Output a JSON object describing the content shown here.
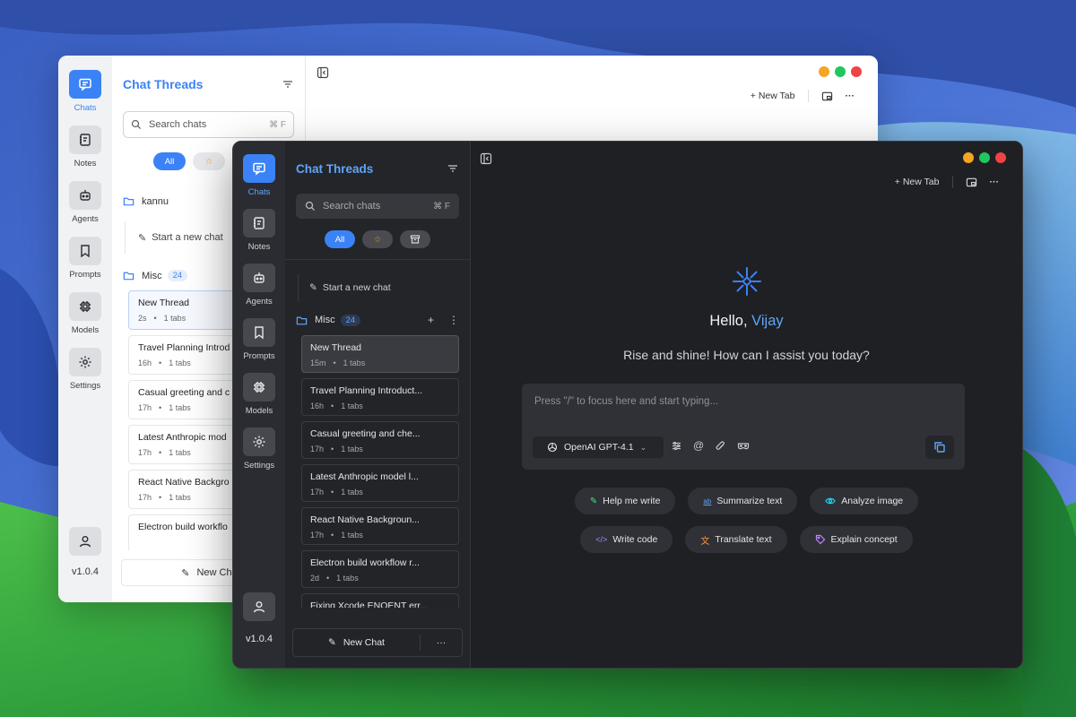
{
  "light_window": {
    "rail": [
      {
        "label": "Chats"
      },
      {
        "label": "Notes"
      },
      {
        "label": "Agents"
      },
      {
        "label": "Prompts"
      },
      {
        "label": "Models"
      },
      {
        "label": "Settings"
      }
    ],
    "version": "v1.0.4",
    "panel_title": "Chat Threads",
    "search_placeholder": "Search chats",
    "search_shortcut": "⌘ F",
    "filter_all": "All",
    "folder_kannu": "kannu",
    "start_new_chat": "Start a new chat",
    "folder_misc": "Misc",
    "misc_count": "24",
    "threads": [
      {
        "title": "New Thread",
        "age": "2s",
        "tabs": "1 tabs"
      },
      {
        "title": "Travel Planning Introd",
        "age": "16h",
        "tabs": "1 tabs"
      },
      {
        "title": "Casual greeting and c",
        "age": "17h",
        "tabs": "1 tabs"
      },
      {
        "title": "Latest Anthropic mod",
        "age": "17h",
        "tabs": "1 tabs"
      },
      {
        "title": "React Native Backgro",
        "age": "17h",
        "tabs": "1 tabs"
      },
      {
        "title": "Electron build workflo",
        "age": "",
        "tabs": ""
      }
    ],
    "new_chat": "New Chat",
    "new_tab": "New Tab"
  },
  "dark_window": {
    "rail": [
      {
        "label": "Chats"
      },
      {
        "label": "Notes"
      },
      {
        "label": "Agents"
      },
      {
        "label": "Prompts"
      },
      {
        "label": "Models"
      },
      {
        "label": "Settings"
      }
    ],
    "version": "v1.0.4",
    "panel_title": "Chat Threads",
    "search_placeholder": "Search chats",
    "search_shortcut": "⌘ F",
    "filter_all": "All",
    "start_new_chat": "Start a new chat",
    "folder_misc": "Misc",
    "misc_count": "24",
    "threads": [
      {
        "title": "New Thread",
        "age": "15m",
        "tabs": "1 tabs"
      },
      {
        "title": "Travel Planning Introduct...",
        "age": "16h",
        "tabs": "1 tabs"
      },
      {
        "title": "Casual greeting and che...",
        "age": "17h",
        "tabs": "1 tabs"
      },
      {
        "title": "Latest Anthropic model l...",
        "age": "17h",
        "tabs": "1 tabs"
      },
      {
        "title": "React Native Backgroun...",
        "age": "17h",
        "tabs": "1 tabs"
      },
      {
        "title": "Electron build workflow r...",
        "age": "2d",
        "tabs": "1 tabs"
      },
      {
        "title": "Fixing Xcode ENOENT err...",
        "age": "",
        "tabs": ""
      }
    ],
    "new_chat": "New Chat",
    "more": "···",
    "new_tab": "New Tab",
    "hello": "Hello,",
    "user_name": "Vijay",
    "subtitle": "Rise and shine! How can I assist you today?",
    "composer_placeholder": "Press \"/\" to focus here and start typing...",
    "model": "OpenAI GPT-4.1",
    "suggestions_row1": [
      {
        "label": "Help me write",
        "icon": "pencil-icon",
        "color": "#4ade80"
      },
      {
        "label": "Summarize text",
        "icon": "ab-icon",
        "color": "#60a5fa"
      },
      {
        "label": "Analyze image",
        "icon": "eye-icon",
        "color": "#22d3ee"
      }
    ],
    "suggestions_row2": [
      {
        "label": "Write code",
        "icon": "code-icon",
        "color": "#a78bfa"
      },
      {
        "label": "Translate text",
        "icon": "translate-icon",
        "color": "#fb923c"
      },
      {
        "label": "Explain concept",
        "icon": "tag-icon",
        "color": "#c084fc"
      }
    ]
  },
  "colors": {
    "accent": "#3b82f6",
    "accent_light": "#60a5fa",
    "traffic_yellow": "#f5a524",
    "traffic_green": "#22c55e",
    "traffic_red": "#ef4444"
  }
}
